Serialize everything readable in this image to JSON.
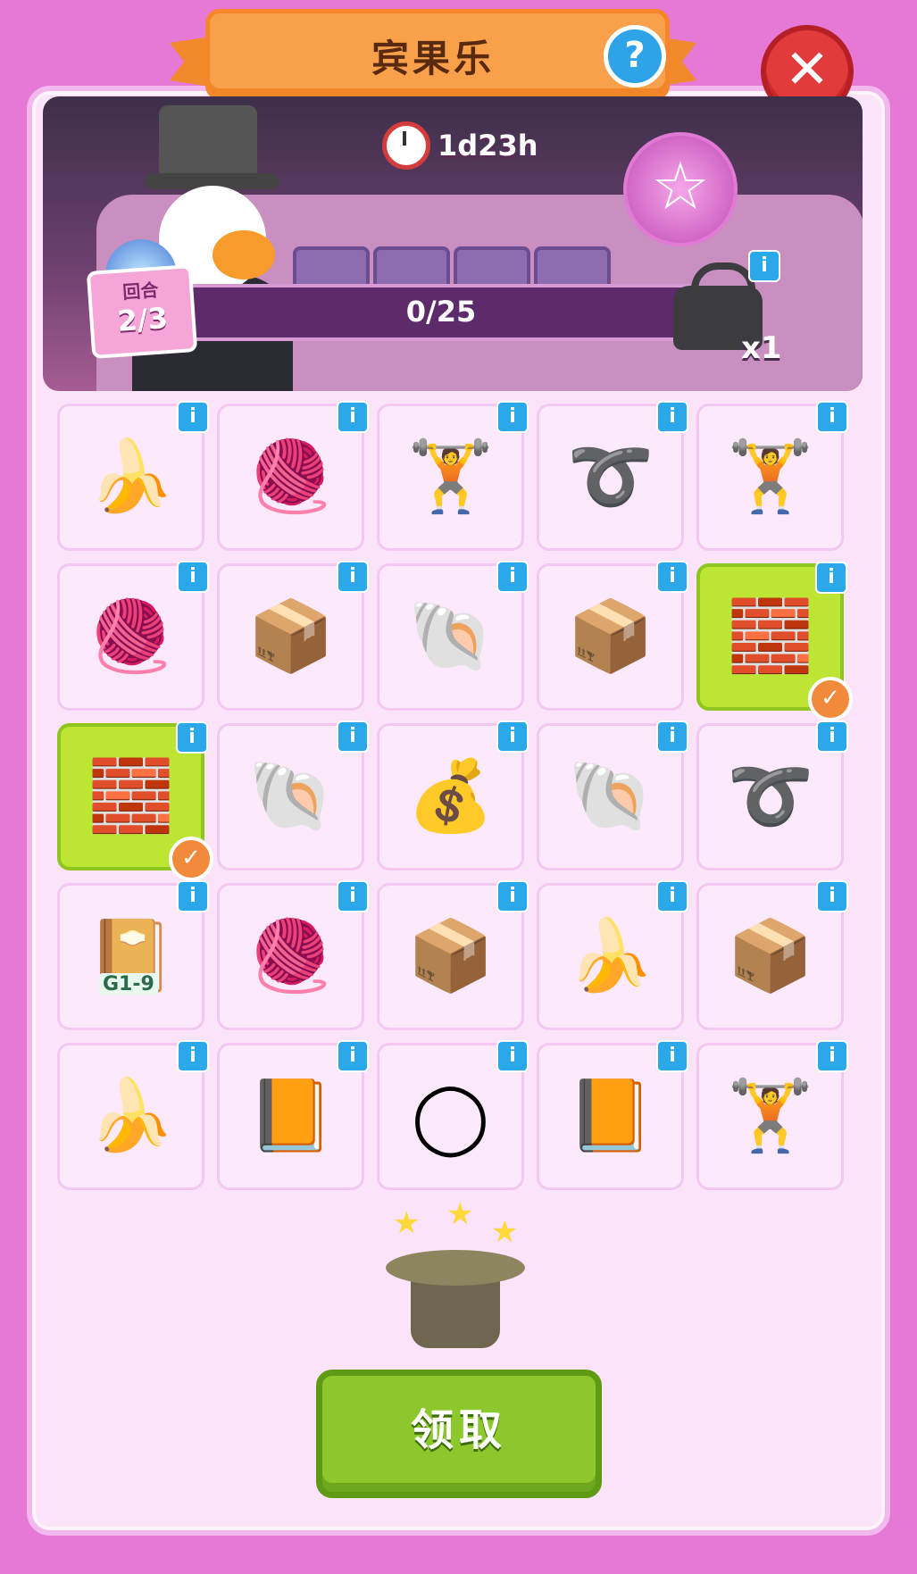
{
  "header": {
    "title": "宾果乐",
    "help_icon": "?",
    "close_icon": "✕"
  },
  "event": {
    "timer": "1d23h",
    "round_label": "回合",
    "round_value": "2/3",
    "progress_text": "0/25",
    "progress_fraction": 0.0,
    "bag_count": "x1"
  },
  "grid": {
    "rows": [
      [
        {
          "item": "banana-peel-icon",
          "glyph": "🍌",
          "checked": false
        },
        {
          "item": "yarn-ball-icon",
          "glyph": "🧶",
          "checked": false
        },
        {
          "item": "dumbbell-icon",
          "glyph": "🏋",
          "checked": false
        },
        {
          "item": "jump-rope-icon",
          "glyph": "➰",
          "checked": false
        },
        {
          "item": "dumbbell-icon",
          "glyph": "🏋",
          "checked": false
        }
      ],
      [
        {
          "item": "yarn-ball-icon",
          "glyph": "🧶",
          "checked": false
        },
        {
          "item": "cardboard-box-icon",
          "glyph": "📦",
          "checked": false
        },
        {
          "item": "snail-shell-icon",
          "glyph": "🐚",
          "checked": false
        },
        {
          "item": "cardboard-box-icon",
          "glyph": "📦",
          "checked": false
        },
        {
          "item": "toy-brick-icon",
          "glyph": "🧱",
          "checked": true
        }
      ],
      [
        {
          "item": "toy-brick-icon",
          "glyph": "🧱",
          "checked": true
        },
        {
          "item": "snail-shell-icon",
          "glyph": "🐚",
          "checked": false
        },
        {
          "item": "sack-icon",
          "glyph": "💰",
          "checked": false
        },
        {
          "item": "snail-shell-icon",
          "glyph": "🐚",
          "checked": false
        },
        {
          "item": "jump-rope-icon",
          "glyph": "➰",
          "checked": false
        }
      ],
      [
        {
          "item": "sticker-book-icon",
          "glyph": "📔",
          "label": "G1-9",
          "checked": false
        },
        {
          "item": "yarn-ball-icon",
          "glyph": "🧶",
          "checked": false
        },
        {
          "item": "cardboard-box-icon",
          "glyph": "📦",
          "checked": false
        },
        {
          "item": "banana-peel-icon",
          "glyph": "🍌",
          "checked": false
        },
        {
          "item": "cardboard-box-icon",
          "glyph": "📦",
          "checked": false
        }
      ],
      [
        {
          "item": "banana-peel-icon",
          "glyph": "🍌",
          "checked": false
        },
        {
          "item": "comic-book-icon",
          "glyph": "📙",
          "checked": false
        },
        {
          "item": "hoop-icon",
          "glyph": "◯",
          "checked": false
        },
        {
          "item": "comic-book-icon",
          "glyph": "📙",
          "checked": false
        },
        {
          "item": "dumbbell-icon",
          "glyph": "🏋",
          "checked": false
        }
      ]
    ]
  },
  "footer": {
    "claim_label": "领取"
  },
  "colors": {
    "accent_orange": "#f8a04a",
    "checked_green": "#bde634",
    "claim_green": "#8cc82b",
    "info_blue": "#2aa8ea"
  }
}
